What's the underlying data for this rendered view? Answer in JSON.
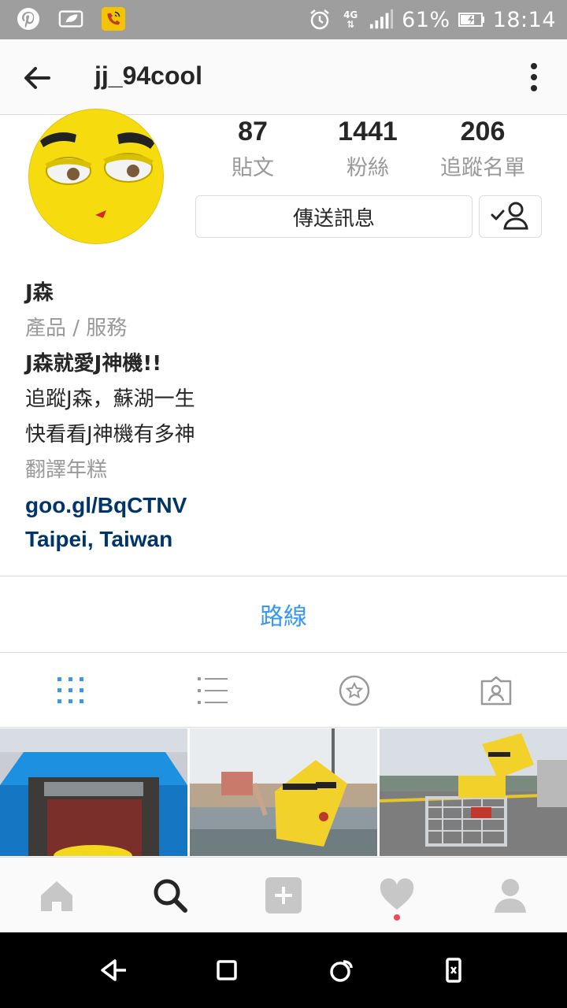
{
  "status_bar": {
    "network": "4G",
    "battery": "61%",
    "time": "18:14",
    "icons": [
      "pinterest-icon",
      "leaf-notification-icon",
      "phone-app-icon",
      "alarm-icon",
      "signal-icon",
      "battery-icon"
    ]
  },
  "header": {
    "username": "jj_94cool"
  },
  "profile": {
    "stats": [
      {
        "count": "87",
        "label": "貼文"
      },
      {
        "count": "1441",
        "label": "粉絲"
      },
      {
        "count": "206",
        "label": "追蹤名單"
      }
    ],
    "message_button": "傳送訊息"
  },
  "bio": {
    "name": "J森",
    "category": "產品 / 服務",
    "lines": [
      "J森就愛J神機!!",
      "追蹤J森，蘇湖一生",
      "快看看J神機有多神"
    ],
    "translate": "翻譯年糕",
    "website": "goo.gl/BqCTNV",
    "location": "Taipei, Taiwan"
  },
  "directions": "路線",
  "colors": {
    "accent": "#3897f0",
    "link": "#003569",
    "status_bar": "#9e9e9e",
    "avatar_yellow": "#f6dc0f"
  }
}
